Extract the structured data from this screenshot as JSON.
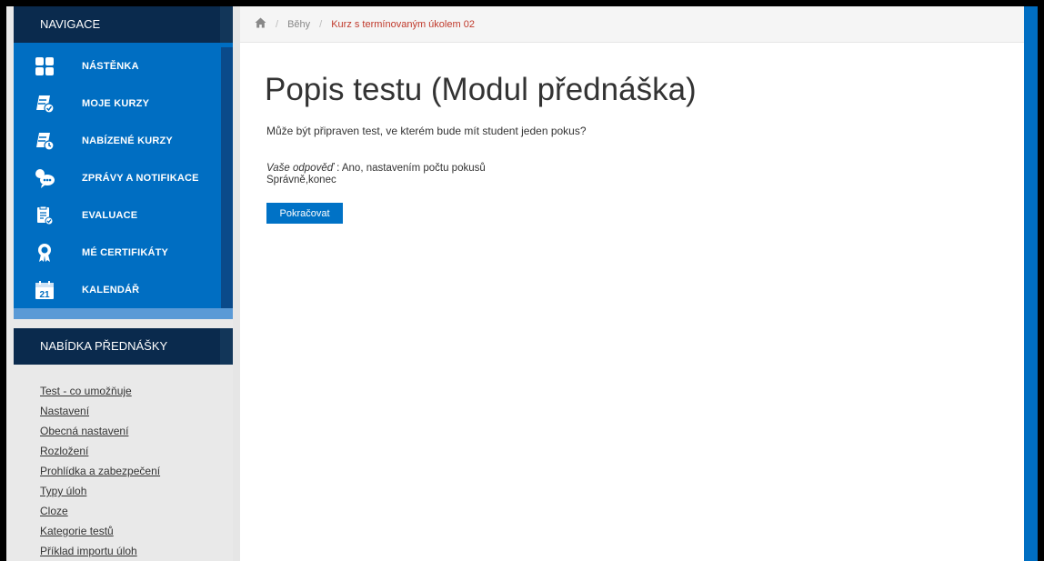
{
  "sidebar": {
    "nav_title": "NAVIGACE",
    "items": [
      {
        "label": "NÁSTĚNKA",
        "icon": "dashboard-icon"
      },
      {
        "label": "MOJE KURZY",
        "icon": "my-courses-icon"
      },
      {
        "label": "NABÍZENÉ KURZY",
        "icon": "offered-courses-icon"
      },
      {
        "label": "ZPRÁVY A NOTIFIKACE",
        "icon": "messages-icon"
      },
      {
        "label": "EVALUACE",
        "icon": "evaluation-icon"
      },
      {
        "label": "MÉ CERTIFIKÁTY",
        "icon": "certificate-icon"
      },
      {
        "label": "KALENDÁŘ",
        "icon": "calendar-icon"
      }
    ],
    "calendar_day": "21",
    "menu_title": "NABÍDKA PŘEDNÁŠKY",
    "menu_links": [
      "Test - co umožňuje",
      "Nastavení",
      "Obecná nastavení",
      "Rozložení",
      "Prohlídka a zabezpečení",
      "Typy úloh",
      "Cloze",
      "Kategorie testů",
      "Příklad importu úloh"
    ]
  },
  "breadcrumb": {
    "sep": "/",
    "items": [
      "Běhy",
      "Kurz s termínovaným úkolem 02"
    ]
  },
  "main": {
    "title": "Popis testu (Modul přednáška)",
    "question": "Může být připraven test, ve kterém bude mít  student jeden pokus?",
    "answer_label": "Vaše odpověď",
    "answer_value": " : Ano, nastavením počtu pokusů",
    "feedback": "Správně,konec",
    "continue_label": "Pokračovat"
  },
  "colors": {
    "sidebar_blue": "#006ec2",
    "header_navy": "#0a2a4d",
    "button_blue": "#0072c6",
    "breadcrumb_current": "#c0392b"
  }
}
